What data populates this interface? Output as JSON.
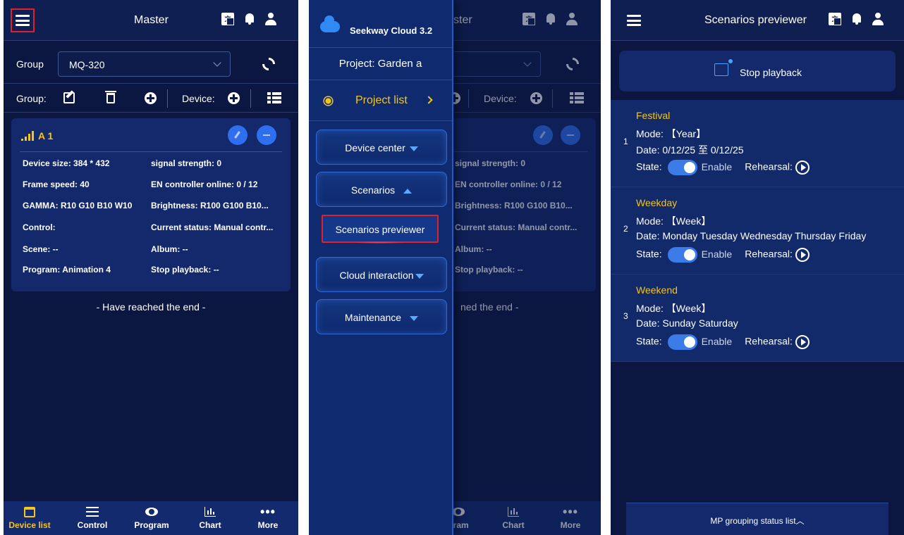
{
  "p1": {
    "title": "Master",
    "group_label": "Group",
    "group_value": "MQ-320",
    "toolbar": {
      "group_label": "Group:",
      "device_label": "Device:"
    },
    "device": {
      "name": "A 1",
      "rows": [
        {
          "l": "Device size:  384 * 432",
          "r": "signal strength:  0"
        },
        {
          "l": "Frame speed:  40",
          "r": "EN controller online:  0 / 12"
        },
        {
          "l": "GAMMA:  R10 G10 B10 W10",
          "r": "Brightness:  R100 G100 B10..."
        },
        {
          "l": "Control:",
          "r": "Current status:  Manual contr..."
        },
        {
          "l": "Scene:  --",
          "r": "Album:  --"
        },
        {
          "l": "Program:  Animation 4",
          "r": "Stop playback:  --"
        }
      ]
    },
    "end_text": "- Have reached the end -",
    "nav": [
      "Device list",
      "Control",
      "Program",
      "Chart",
      "More"
    ]
  },
  "p2": {
    "header_fragment": "ster",
    "app_name": "Seekway Cloud 3.2",
    "project": "Project: Garden a",
    "project_list": "Project list",
    "device_center": "Device center",
    "scenarios": "Scenarios",
    "scenarios_previewer": "Scenarios previewer",
    "cloud_interaction": "Cloud interaction",
    "maintenance": "Maintenance",
    "bg": {
      "device_label": "Device:",
      "rows": [
        "signal strength:  0",
        "EN controller online:  0 / 12",
        "Brightness:  R100 G100 B10...",
        "Current status:  Manual contr...",
        "Album:  --",
        "Stop playback:  --"
      ],
      "end_fragment": "ned the end -",
      "nav": [
        "gram",
        "Chart",
        "More"
      ]
    }
  },
  "p3": {
    "title": "Scenarios previewer",
    "stop": "Stop playback",
    "scenarios": [
      {
        "idx": "1",
        "name": "Festival",
        "mode": "Mode:   【Year】",
        "date": "Date:  0/12/25 至 0/12/25"
      },
      {
        "idx": "2",
        "name": "Weekday",
        "mode": "Mode:   【Week】",
        "date": "Date:  Monday Tuesday Wednesday Thursday Friday"
      },
      {
        "idx": "3",
        "name": "Weekend",
        "mode": "Mode:   【Week】",
        "date": "Date:  Sunday Saturday"
      }
    ],
    "state_label": "State:",
    "enable_label": "Enable",
    "rehearsal_label": "Rehearsal:",
    "mp_bar": "MP grouping status list︿"
  },
  "colors": {
    "accent": "#f5c518",
    "bg": "#0b1740",
    "highlight": "#e0202a",
    "toggle": "#3b7ce8"
  }
}
